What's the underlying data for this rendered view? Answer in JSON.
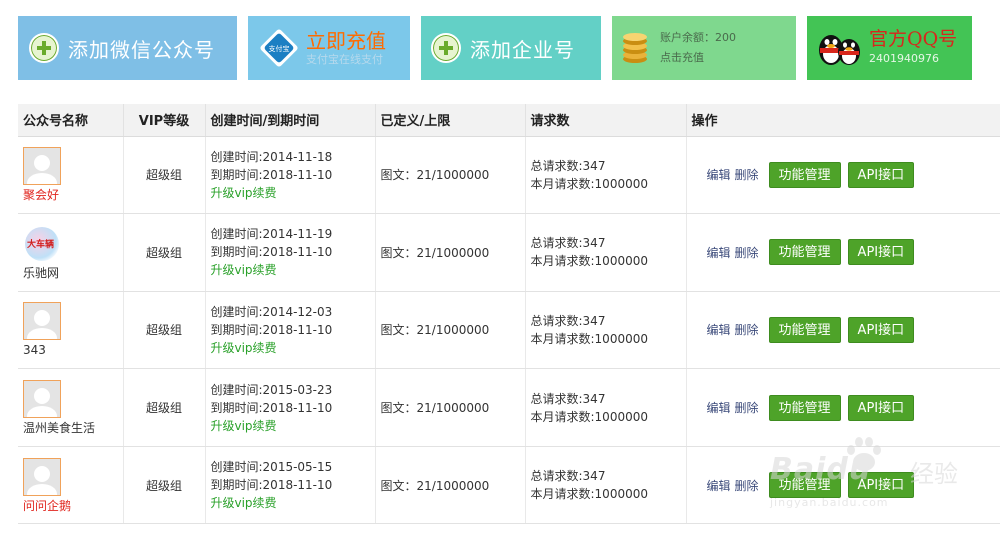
{
  "tiles": {
    "add_wechat": {
      "label": "添加微信公众号",
      "icon": "plus-circle-icon"
    },
    "recharge": {
      "title": "立即充值",
      "subtitle": "支付宝在线支付",
      "badge_text": "支付宝",
      "icon": "alipay-icon"
    },
    "add_enterprise": {
      "label": "添加企业号",
      "icon": "plus-circle-icon"
    },
    "balance": {
      "line1": "账户余额：200",
      "line2": "点击充值",
      "icon": "coins-icon"
    },
    "qq": {
      "title": "官方QQ号",
      "number": "2401940976",
      "icon": "qq-penguin-icon"
    }
  },
  "table": {
    "headers": {
      "name": "公众号名称",
      "vip": "VIP等级",
      "time": "创建时间/到期时间",
      "limit": "已定义/上限",
      "requests": "请求数",
      "actions": "操作"
    },
    "rows": [
      {
        "name": "聚会好",
        "name_color": "red",
        "avatar": "default-avatar",
        "vip": "超级组",
        "created": "创建时间:2014-11-18",
        "expires": "到期时间:2018-11-10",
        "upgrade": "升级vip续费",
        "limit": "图文：21/1000000",
        "total_requests": "总请求数:347",
        "month_requests": "本月请求数:1000000",
        "edit": "编辑",
        "delete": "删除",
        "func_btn": "功能管理",
        "api_btn": "API接口"
      },
      {
        "name": "乐驰网",
        "name_color": "dark",
        "avatar": "logo-avatar",
        "avatar_text": "大车辆",
        "vip": "超级组",
        "created": "创建时间:2014-11-19",
        "expires": "到期时间:2018-11-10",
        "upgrade": "升级vip续费",
        "limit": "图文：21/1000000",
        "total_requests": "总请求数:347",
        "month_requests": "本月请求数:1000000",
        "edit": "编辑",
        "delete": "删除",
        "func_btn": "功能管理",
        "api_btn": "API接口"
      },
      {
        "name": "343",
        "name_color": "dark",
        "avatar": "default-avatar",
        "vip": "超级组",
        "created": "创建时间:2014-12-03",
        "expires": "到期时间:2018-11-10",
        "upgrade": "升级vip续费",
        "limit": "图文：21/1000000",
        "total_requests": "总请求数:347",
        "month_requests": "本月请求数:1000000",
        "edit": "编辑",
        "delete": "删除",
        "func_btn": "功能管理",
        "api_btn": "API接口"
      },
      {
        "name": "温州美食生活",
        "name_color": "dark",
        "avatar": "default-avatar",
        "vip": "超级组",
        "created": "创建时间:2015-03-23",
        "expires": "到期时间:2018-11-10",
        "upgrade": "升级vip续费",
        "limit": "图文：21/1000000",
        "total_requests": "总请求数:347",
        "month_requests": "本月请求数:1000000",
        "edit": "编辑",
        "delete": "删除",
        "func_btn": "功能管理",
        "api_btn": "API接口"
      },
      {
        "name": "问问企鹅",
        "name_color": "red",
        "avatar": "default-avatar",
        "vip": "超级组",
        "created": "创建时间:2015-05-15",
        "expires": "到期时间:2018-11-10",
        "upgrade": "升级vip续费",
        "limit": "图文：21/1000000",
        "total_requests": "总请求数:347",
        "month_requests": "本月请求数:1000000",
        "edit": "编辑",
        "delete": "删除",
        "func_btn": "功能管理",
        "api_btn": "API接口"
      }
    ]
  },
  "watermark": {
    "brand": "Baidu",
    "cn": "经验",
    "url": "jingyan.baidu.com"
  },
  "colors": {
    "tile_wechat": "#7fbfe6",
    "tile_recharge": "#7cc8ea",
    "tile_enterprise": "#63d0c6",
    "tile_balance": "#7fd88e",
    "tile_qq": "#43c455",
    "button_green": "#4ea329",
    "upgrade_link": "#2aa12a",
    "name_red": "#e0261f"
  }
}
